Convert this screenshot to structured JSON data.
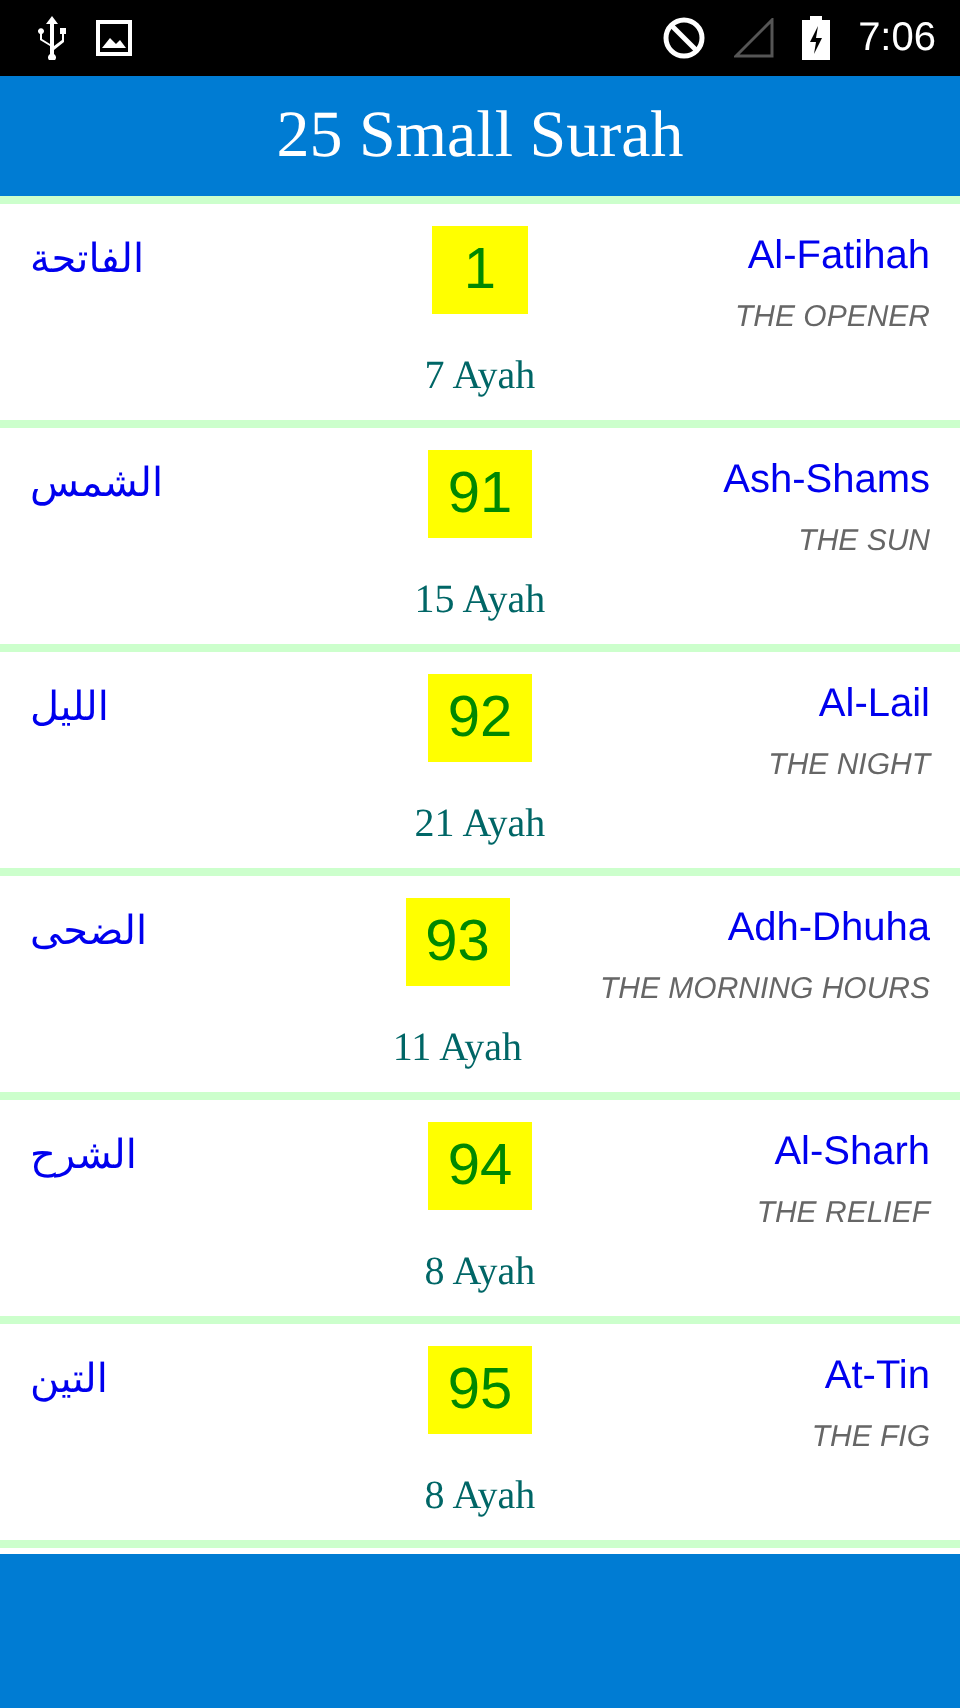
{
  "status_bar": {
    "time": "7:06"
  },
  "title": "25 Small Surah",
  "surahs": [
    {
      "arabic": "الفاتحة",
      "number": "1",
      "name": "Al-Fatihah",
      "meaning": "THE OPENER",
      "ayah": "7 Ayah"
    },
    {
      "arabic": "الشمس",
      "number": "91",
      "name": "Ash-Shams",
      "meaning": "THE SUN",
      "ayah": "15 Ayah"
    },
    {
      "arabic": "الليل",
      "number": "92",
      "name": "Al-Lail",
      "meaning": "THE NIGHT",
      "ayah": "21 Ayah"
    },
    {
      "arabic": "الضحى",
      "number": "93",
      "name": "Adh-Dhuha",
      "meaning": "THE MORNING HOURS",
      "ayah": "11 Ayah"
    },
    {
      "arabic": "الشرح",
      "number": "94",
      "name": "Al-Sharh",
      "meaning": "THE RELIEF",
      "ayah": "8 Ayah"
    },
    {
      "arabic": "التين",
      "number": "95",
      "name": "At-Tin",
      "meaning": "THE FIG",
      "ayah": "8 Ayah"
    }
  ]
}
